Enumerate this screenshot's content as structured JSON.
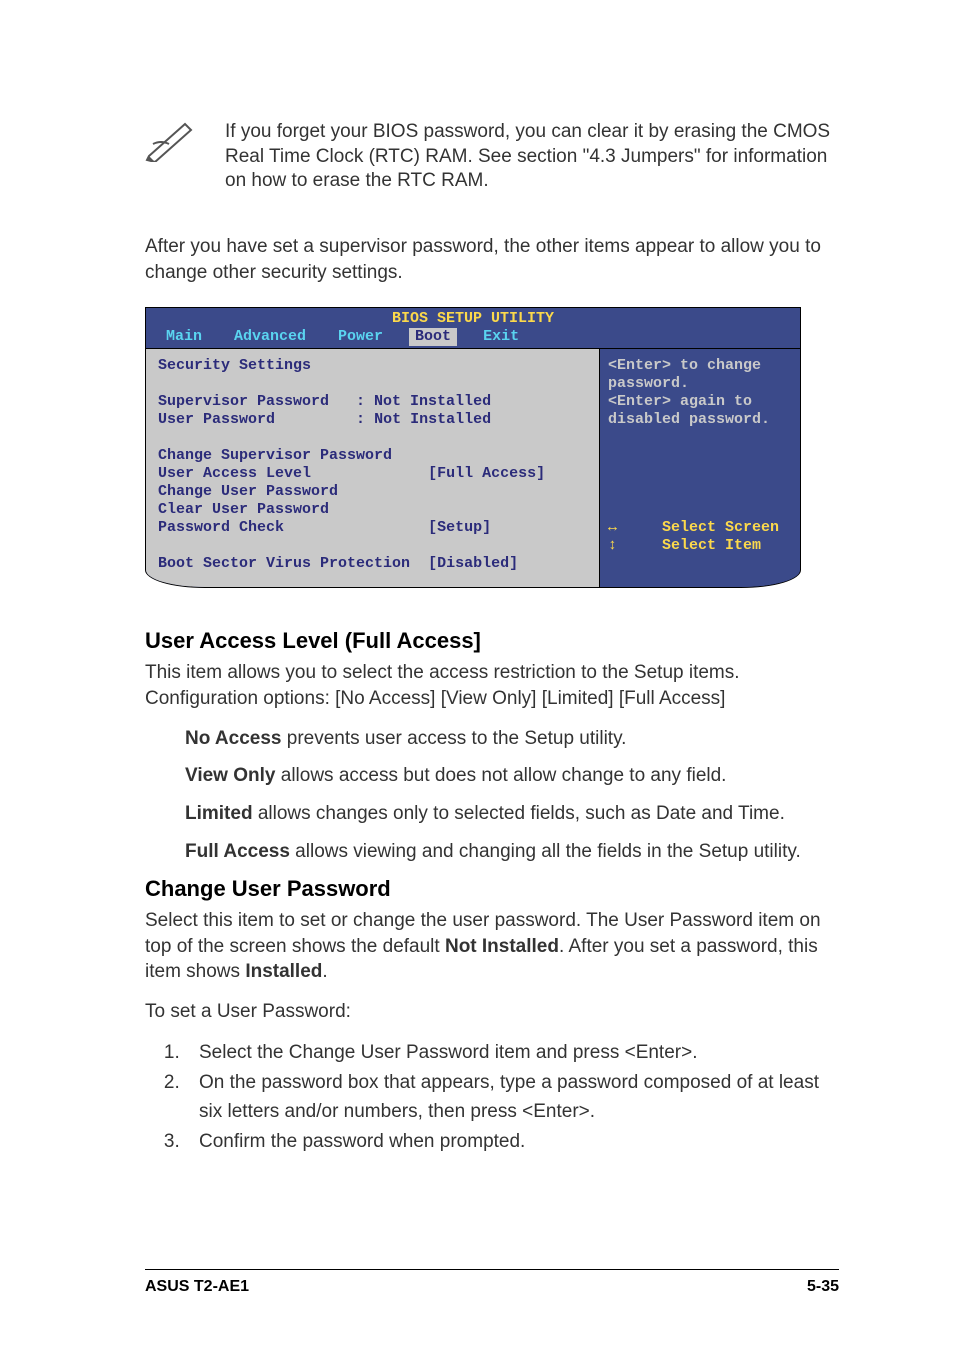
{
  "note": "If you forget your BIOS password, you can clear it by erasing the CMOS Real Time Clock (RTC) RAM. See section \"4.3 Jumpers\" for information on how to erase the RTC RAM.",
  "intro": "After you have set a supervisor password, the other items appear to allow you to change other security settings.",
  "bios": {
    "title": "BIOS SETUP UTILITY",
    "tabs": [
      "Main",
      "Advanced",
      "Power",
      "Boot",
      "Exit"
    ],
    "selected_tab": "Boot",
    "section_heading": "Security Settings",
    "fields": {
      "supervisor_password_label": "Supervisor Password",
      "supervisor_password_value": "Not Installed",
      "user_password_label": "User Password",
      "user_password_value": "Not Installed",
      "change_supervisor_password": "Change Supervisor Password",
      "user_access_level_label": "User Access Level",
      "user_access_level_value": "[Full Access]",
      "change_user_password": "Change User Password",
      "clear_user_password": "Clear User Password",
      "password_check_label": "Password Check",
      "password_check_value": "[Setup]",
      "boot_sector_label": "Boot Sector Virus Protection",
      "boot_sector_value": "[Disabled]"
    },
    "help": [
      "<Enter> to change",
      "password.",
      "<Enter> again to",
      "disabled password."
    ],
    "nav": {
      "select_screen": "Select Screen",
      "select_item": "Select Item"
    }
  },
  "sections": {
    "user_access": {
      "heading": "User Access Level (Full Access]",
      "p1": "This item allows you to select the access restriction to the Setup items. Configuration options: [No Access] [View Only] [Limited] [Full Access]",
      "opts": [
        {
          "label": "No Access",
          "text": " prevents user access to the Setup utility."
        },
        {
          "label": "View Only",
          "text": " allows access but does not allow change to any field."
        },
        {
          "label": "Limited",
          "text": " allows changes only to selected fields, such as Date and Time."
        },
        {
          "label": "Full Access",
          "text": " allows viewing and changing all the fields in the Setup utility."
        }
      ]
    },
    "change_user_pw": {
      "heading": "Change User Password",
      "p1_pre": "Select this item to set or change the user password. The User Password item on top of the screen shows the default ",
      "p1_bold1": "Not Installed",
      "p1_mid": ". After you set a password, this item shows ",
      "p1_bold2": "Installed",
      "p1_post": ".",
      "p2": "To set a User Password:",
      "steps": [
        "Select the Change User Password item and press <Enter>.",
        "On the password box that appears, type a password composed of at least six letters and/or numbers, then press <Enter>.",
        "Confirm the password when prompted."
      ]
    }
  },
  "footer": {
    "left": "ASUS T2-AE1",
    "right": "5-35"
  }
}
